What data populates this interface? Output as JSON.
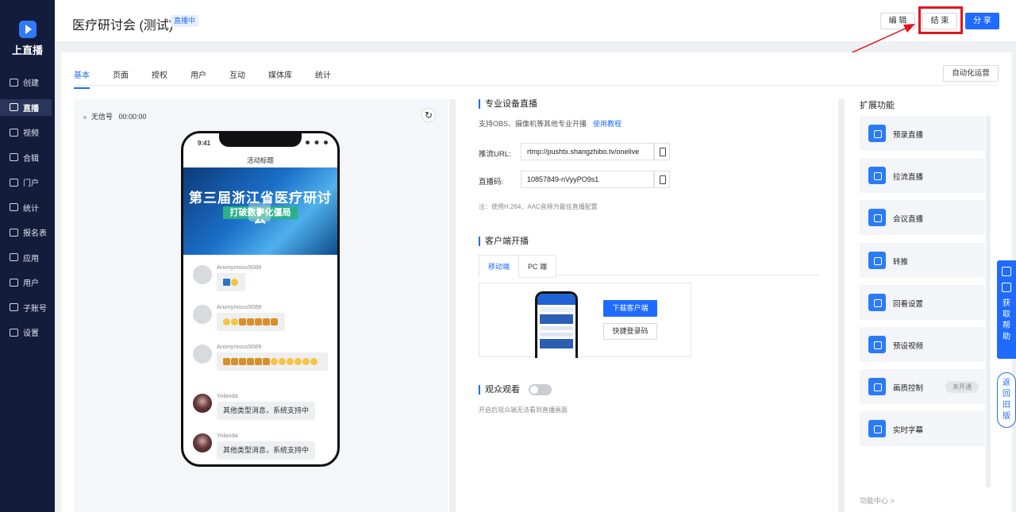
{
  "app": {
    "logo_text": "上直播"
  },
  "sidebar": {
    "items": [
      {
        "label": "创建",
        "icon": "plus-square-icon"
      },
      {
        "label": "直播",
        "icon": "video-camera-icon",
        "active": true
      },
      {
        "label": "视频",
        "icon": "film-icon"
      },
      {
        "label": "合辑",
        "icon": "collection-icon"
      },
      {
        "label": "门户",
        "icon": "monitor-icon"
      },
      {
        "label": "统计",
        "icon": "pie-chart-icon"
      },
      {
        "label": "报名表",
        "icon": "form-icon"
      },
      {
        "label": "应用",
        "icon": "grid-icon"
      },
      {
        "label": "用户",
        "icon": "user-icon"
      },
      {
        "label": "子账号",
        "icon": "sub-account-icon"
      },
      {
        "label": "设置",
        "icon": "gear-icon"
      }
    ]
  },
  "header": {
    "title": "医疗研讨会 (测试)",
    "status_badge": "直播中",
    "edit_label": "编 辑",
    "end_label": "结 束",
    "share_label": "分 享"
  },
  "tabs": [
    "基本",
    "页面",
    "授权",
    "用户",
    "互动",
    "媒体库",
    "统计"
  ],
  "auto_ops_label": "自动化运营",
  "preview": {
    "signal_label": "无信号",
    "timer": "00:00:00",
    "phone": {
      "time": "9:41",
      "title": "活动标题",
      "banner_line1": "第三届浙江省医疗研讨会",
      "banner_line2": "打破数字化僵局"
    },
    "messages": [
      {
        "name": "Anonymous5089",
        "emoji": [
          "b",
          "y"
        ]
      },
      {
        "name": "Anonymous5089",
        "emoji": [
          "y",
          "y",
          "a",
          "a",
          "a",
          "a",
          "a"
        ]
      },
      {
        "name": "Anonymous5089",
        "emoji": [
          "a",
          "a",
          "a",
          "a",
          "a",
          "a",
          "y",
          "y",
          "y",
          "y",
          "y",
          "y"
        ]
      },
      {
        "name": "Yolanda",
        "text": "其他类型消息，系统支持中"
      },
      {
        "name": "Yolanda",
        "text": "其他类型消息，系统支持中"
      }
    ]
  },
  "pro": {
    "title": "专业设备直播",
    "desc": "支持OBS、摄像机等其他专业开播",
    "tutorial_link": "使用教程",
    "push_url_label": "推流URL:",
    "push_url_value": "rtmp://pushtx.shangzhibo.tv/onelive",
    "stream_key_label": "直播码:",
    "stream_key_value": "10857849-nVyyPO9s1",
    "note": "注：使用H.264、AAC音频为最佳直播配置"
  },
  "client": {
    "title": "客户端开播",
    "tabs": [
      "移动端",
      "PC 端"
    ],
    "download_label": "下载客户端",
    "qr_login_label": "快捷登录码"
  },
  "audience": {
    "title": "观众观看",
    "enabled": false,
    "desc": "开启后观众端无法看到直播画面"
  },
  "extensions": {
    "title": "扩展功能",
    "items": [
      {
        "label": "预录直播",
        "icon": "record-icon"
      },
      {
        "label": "拉流直播",
        "icon": "camera-icon"
      },
      {
        "label": "会议直播",
        "icon": "meeting-icon"
      },
      {
        "label": "转推",
        "icon": "relay-icon"
      },
      {
        "label": "回看设置",
        "icon": "replay-icon"
      },
      {
        "label": "预设视频",
        "icon": "preset-video-icon"
      },
      {
        "label": "画质控制",
        "icon": "hd-icon",
        "tag": "未开通"
      },
      {
        "label": "实时字幕",
        "icon": "subtitle-icon"
      }
    ],
    "center_link": "功能中心 >"
  },
  "side": {
    "help_label": "获取帮助",
    "old_version_label": "返回旧版"
  },
  "colors": {
    "accent": "#1f6bff",
    "sidebar_bg": "#141c3c",
    "highlight": "#e0161e"
  }
}
